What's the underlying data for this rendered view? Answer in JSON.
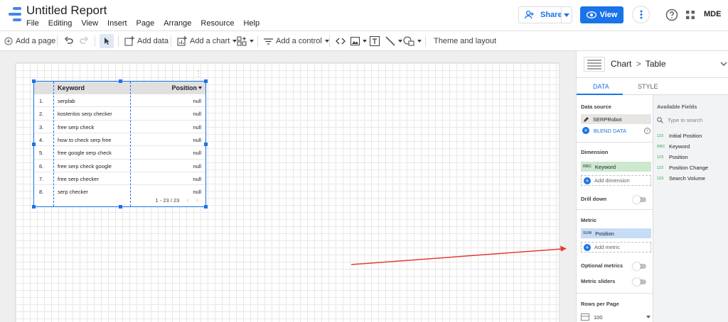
{
  "header": {
    "title": "Untitled Report",
    "menu": [
      "File",
      "Editing",
      "View",
      "Insert",
      "Page",
      "Arrange",
      "Resource",
      "Help"
    ],
    "share_label": "Share",
    "view_label": "View",
    "user_initials": "MDE"
  },
  "toolbar": {
    "add_page": "Add a page",
    "add_data": "Add data",
    "add_chart": "Add a chart",
    "add_control": "Add a control",
    "theme_layout": "Theme and layout"
  },
  "table": {
    "col_keyword": "Keyword",
    "col_position": "Position",
    "rows": [
      {
        "n": "1.",
        "keyword": "serplab",
        "position": "null"
      },
      {
        "n": "2.",
        "keyword": "kostenlos serp checker",
        "position": "null"
      },
      {
        "n": "3.",
        "keyword": "free serp check",
        "position": "null"
      },
      {
        "n": "4.",
        "keyword": "how to check serp free",
        "position": "null"
      },
      {
        "n": "5.",
        "keyword": "free google serp check",
        "position": "null"
      },
      {
        "n": "6.",
        "keyword": "free serp check google",
        "position": "null"
      },
      {
        "n": "7.",
        "keyword": "free serp checker",
        "position": "null"
      },
      {
        "n": "8.",
        "keyword": "serp checker",
        "position": "null"
      }
    ],
    "pagination": "1 - 23 / 23"
  },
  "panel": {
    "breadcrumb_chart": "Chart",
    "breadcrumb_sep": ">",
    "breadcrumb_table": "Table",
    "tab_data": "DATA",
    "tab_style": "STYLE",
    "data_source_label": "Data source",
    "data_source_name": "SERPRobot",
    "blend_data": "BLEND DATA",
    "dimension_label": "Dimension",
    "dimension_type": "RBC",
    "dimension_name": "Keyword",
    "add_dimension": "Add dimension",
    "drill_down": "Drill down",
    "metric_label": "Metric",
    "metric_type": "SUM",
    "metric_name": "Position",
    "add_metric": "Add metric",
    "optional_metrics": "Optional metrics",
    "metric_sliders": "Metric sliders",
    "rows_per_page_label": "Rows per Page",
    "rows_per_page_value": "100",
    "available_fields_label": "Available Fields",
    "search_placeholder": "Type to search",
    "fields": [
      {
        "type": "123",
        "name": "Initial Position"
      },
      {
        "type": "RBC",
        "name": "Keyword"
      },
      {
        "type": "123",
        "name": "Position"
      },
      {
        "type": "123",
        "name": "Position Change"
      },
      {
        "type": "123",
        "name": "Search Volume"
      }
    ]
  },
  "colors": {
    "accent": "#1a73e8",
    "annotation_arrow": "#e53935",
    "dimension_chip": "#cce8cf",
    "metric_chip": "#c6dcf7"
  }
}
